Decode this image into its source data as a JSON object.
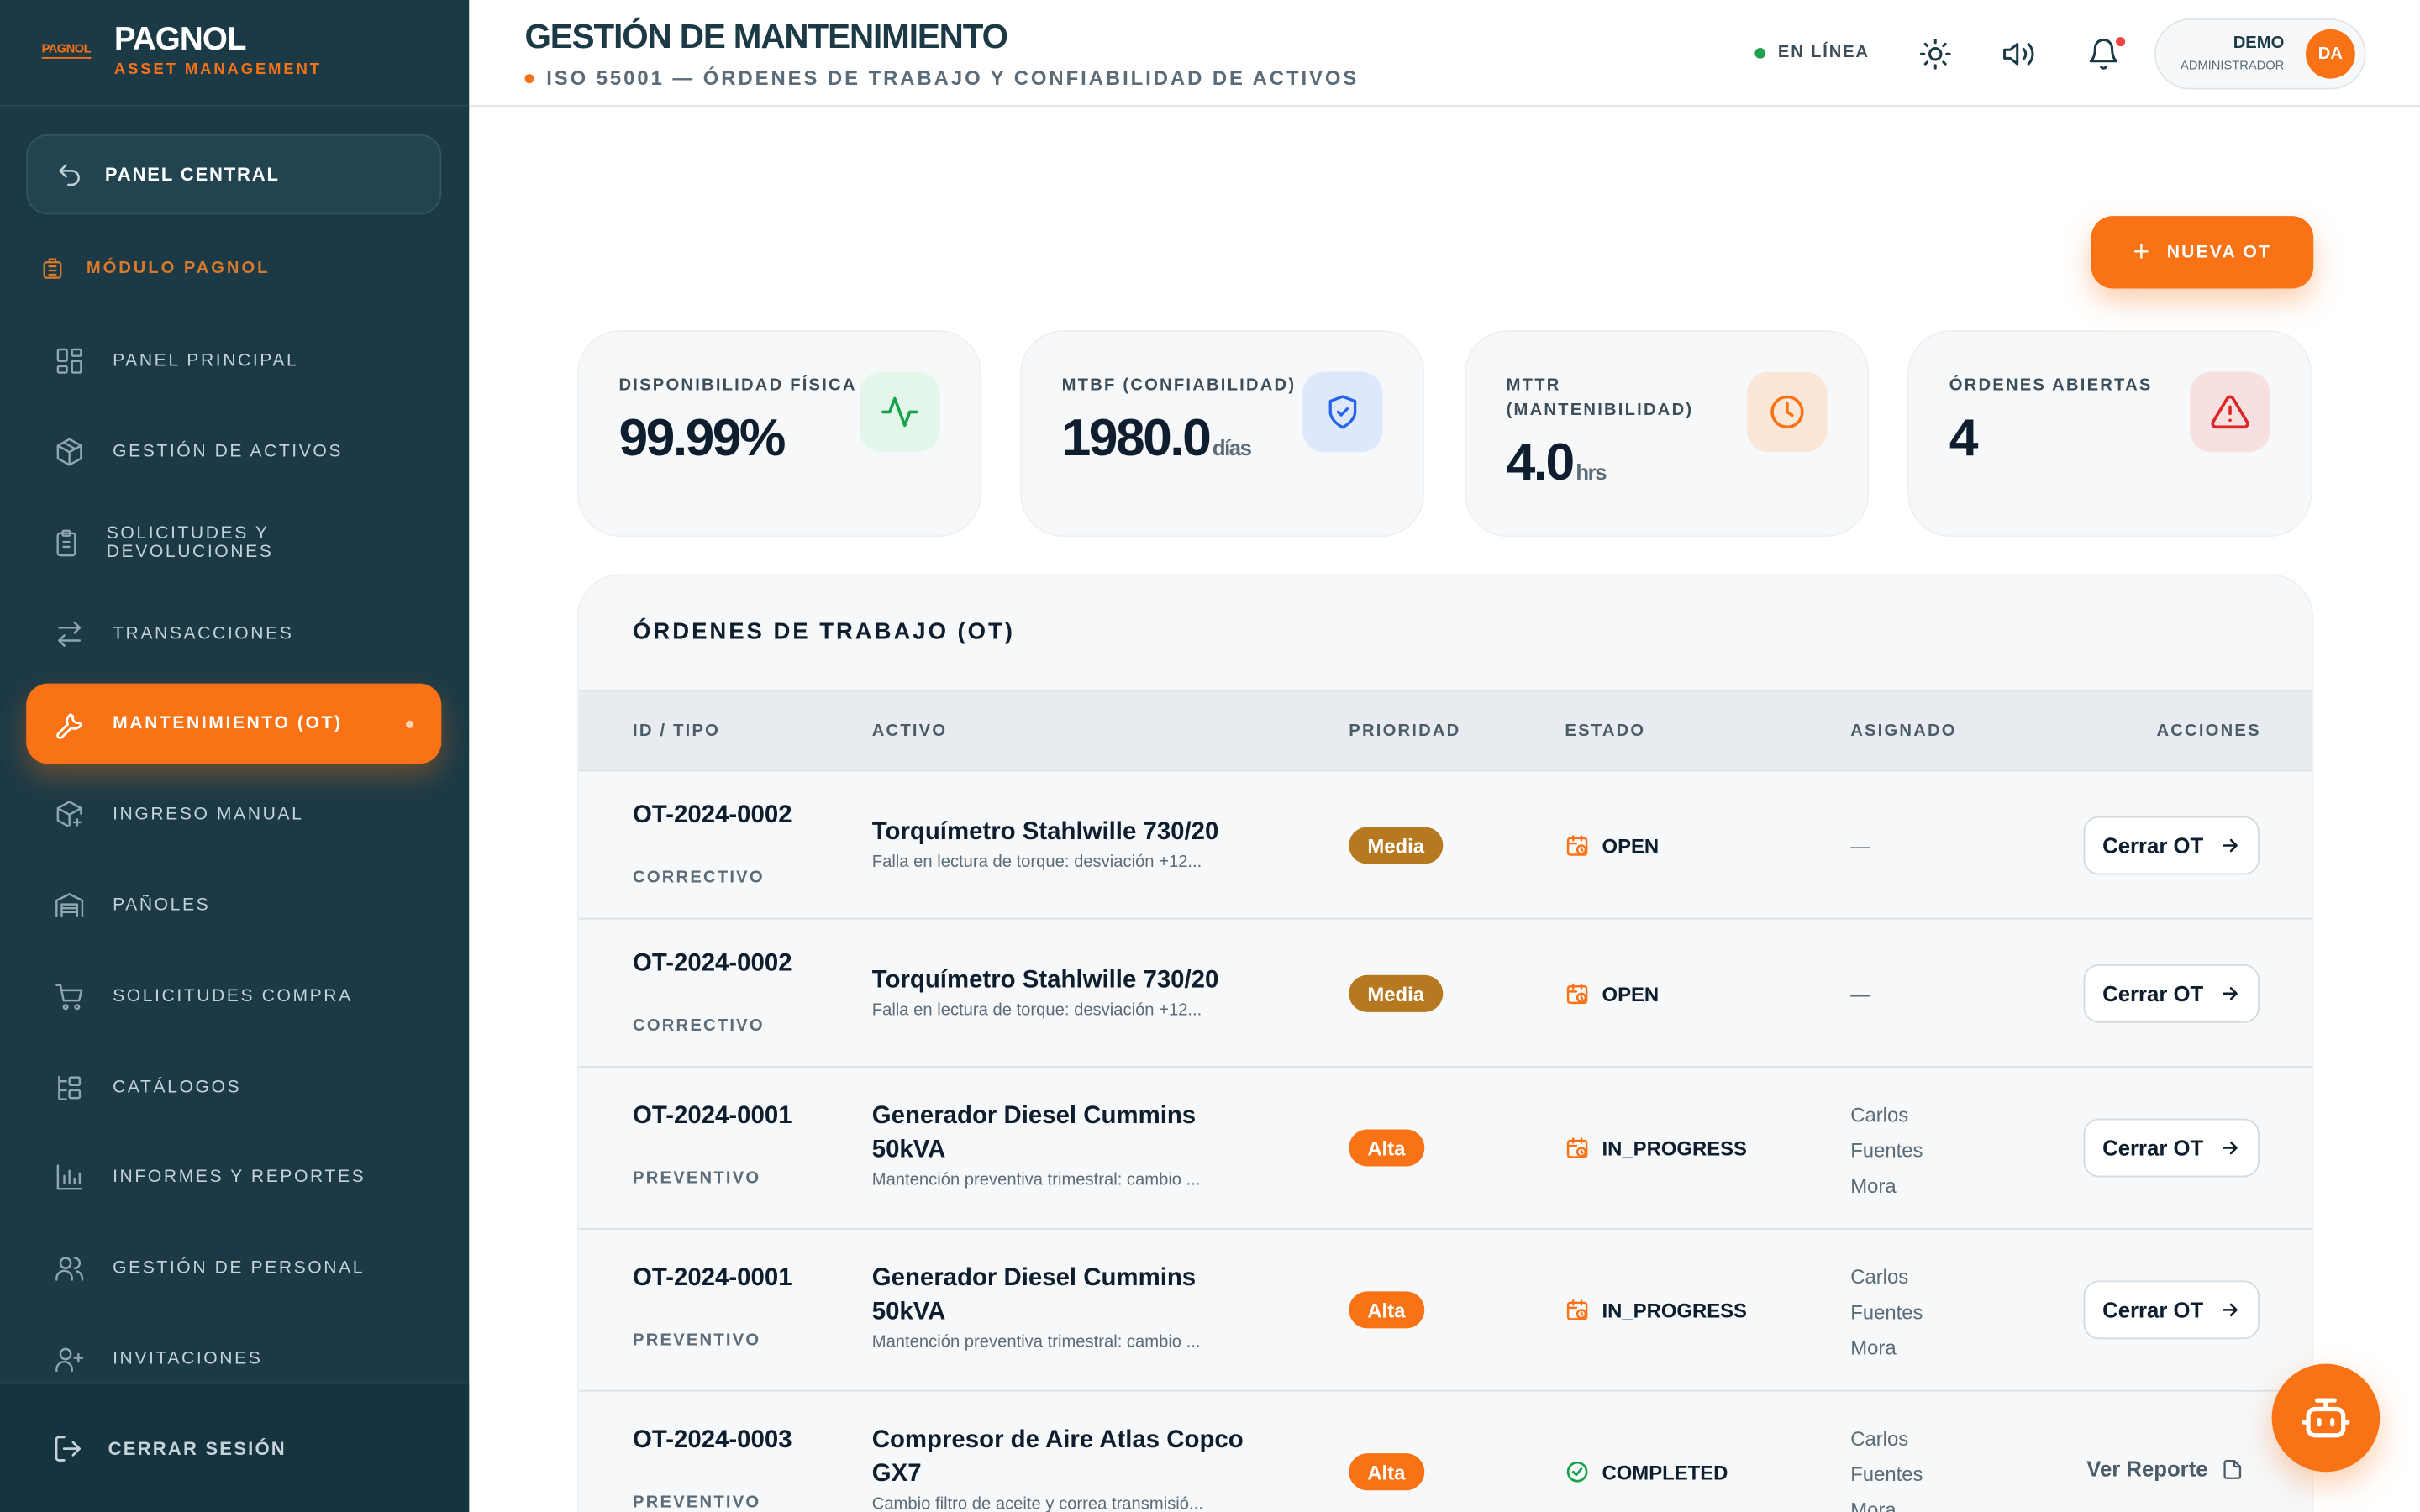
{
  "brand": {
    "mini": "PAGNOL",
    "name": "PAGNOL",
    "sub": "ASSET MANAGEMENT"
  },
  "sidebar": {
    "central": "PANEL CENTRAL",
    "module": "MÓDULO PAGNOL",
    "items": [
      {
        "label": "PANEL PRINCIPAL",
        "icon": "grid-icon"
      },
      {
        "label": "GESTIÓN DE ACTIVOS",
        "icon": "box-icon"
      },
      {
        "label": "SOLICITUDES Y DEVOLUCIONES",
        "icon": "clipboard-icon"
      },
      {
        "label": "TRANSACCIONES",
        "icon": "swap-icon"
      },
      {
        "label": "MANTENIMIENTO (OT)",
        "icon": "wrench-icon",
        "active": true
      },
      {
        "label": "INGRESO MANUAL",
        "icon": "package-plus-icon"
      },
      {
        "label": "PAÑOLES",
        "icon": "warehouse-icon"
      },
      {
        "label": "SOLICITUDES COMPRA",
        "icon": "cart-icon"
      },
      {
        "label": "CATÁLOGOS",
        "icon": "catalog-icon"
      },
      {
        "label": "INFORMES Y REPORTES",
        "icon": "bar-chart-icon"
      },
      {
        "label": "GESTIÓN DE PERSONAL",
        "icon": "users-icon"
      },
      {
        "label": "INVITACIONES",
        "icon": "user-plus-icon"
      }
    ],
    "logout": "CERRAR SESIÓN"
  },
  "header": {
    "title": "GESTIÓN DE MANTENIMIENTO",
    "subtitle": "ISO 55001 — ÓRDENES DE TRABAJO Y CONFIABILIDAD DE ACTIVOS",
    "status": "EN LÍNEA",
    "user_name": "DEMO",
    "user_role": "ADMINISTRADOR",
    "user_initials": "DA"
  },
  "actions": {
    "new_ot": "NUEVA OT"
  },
  "kpis": [
    {
      "label": "DISPONIBILIDAD FÍSICA",
      "value": "99.99%",
      "unit": "",
      "icon": "activity-icon",
      "color": "#16a34a"
    },
    {
      "label": "MTBF (CONFIABILIDAD)",
      "value": "1980.0",
      "unit": "días",
      "icon": "shield-icon",
      "color": "#2563eb"
    },
    {
      "label": "MTTR (MANTENIBILIDAD)",
      "value": "4.0",
      "unit": "hrs",
      "icon": "clock-icon",
      "color": "#f97316"
    },
    {
      "label": "ÓRDENES ABIERTAS",
      "value": "4",
      "unit": "",
      "icon": "alert-icon",
      "color": "#dc2626"
    }
  ],
  "table": {
    "title": "ÓRDENES DE TRABAJO (OT)",
    "columns": [
      "ID / TIPO",
      "ACTIVO",
      "PRIORIDAD",
      "ESTADO",
      "ASIGNADO",
      "ACCIONES"
    ],
    "rows": [
      {
        "id": "OT-2024-0002",
        "tipo": "CORRECTIVO",
        "asset": "Torquímetro Stahlwille 730/20",
        "desc": "Falla en lectura de torque: desviación +12...",
        "prio": "Media",
        "estado": "OPEN",
        "asignado": "—",
        "action": "Cerrar OT"
      },
      {
        "id": "OT-2024-0002",
        "tipo": "CORRECTIVO",
        "asset": "Torquímetro Stahlwille 730/20",
        "desc": "Falla en lectura de torque: desviación +12...",
        "prio": "Media",
        "estado": "OPEN",
        "asignado": "—",
        "action": "Cerrar OT"
      },
      {
        "id": "OT-2024-0001",
        "tipo": "PREVENTIVO",
        "asset": "Generador Diesel Cummins 50kVA",
        "desc": "Mantención preventiva trimestral: cambio ...",
        "prio": "Alta",
        "estado": "IN_PROGRESS",
        "asignado": "Carlos Fuentes Mora",
        "action": "Cerrar OT"
      },
      {
        "id": "OT-2024-0001",
        "tipo": "PREVENTIVO",
        "asset": "Generador Diesel Cummins 50kVA",
        "desc": "Mantención preventiva trimestral: cambio ...",
        "prio": "Alta",
        "estado": "IN_PROGRESS",
        "asignado": "Carlos Fuentes Mora",
        "action": "Cerrar OT"
      },
      {
        "id": "OT-2024-0003",
        "tipo": "PREVENTIVO",
        "asset": "Compresor de Aire Atlas Copco GX7",
        "desc": "Cambio filtro de aceite y correa transmisió...",
        "prio": "Alta",
        "estado": "COMPLETED",
        "asignado": "Carlos Fuentes Mora",
        "action": "Ver Reporte"
      }
    ]
  },
  "colors": {
    "accent": "#f97316",
    "sidebar": "#1b3a46",
    "media": "#b7791f",
    "alta": "#f97316"
  }
}
